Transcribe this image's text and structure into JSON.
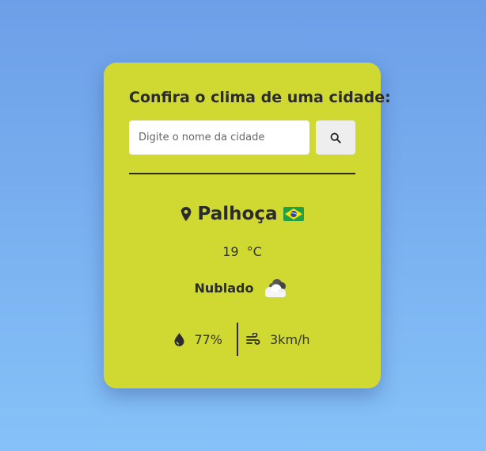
{
  "title": "Confira o clima de uma cidade:",
  "search": {
    "placeholder": "Digite o nome da cidade",
    "value": "",
    "button_icon": "search-icon"
  },
  "weather": {
    "city": "Palhoça",
    "location_icon": "map-pin-icon",
    "flag": "brazil-flag-icon",
    "temperature": "19",
    "unit": "°C",
    "condition": "Nublado",
    "condition_icon": "cloudy-icon",
    "humidity": "77%",
    "humidity_icon": "water-drop-icon",
    "wind": "3km/h",
    "wind_icon": "wind-icon"
  },
  "colors": {
    "card": "#cfd932",
    "text": "#2b2b2b",
    "background_top": "#6d9fe8",
    "background_bottom": "#86c2f8"
  }
}
